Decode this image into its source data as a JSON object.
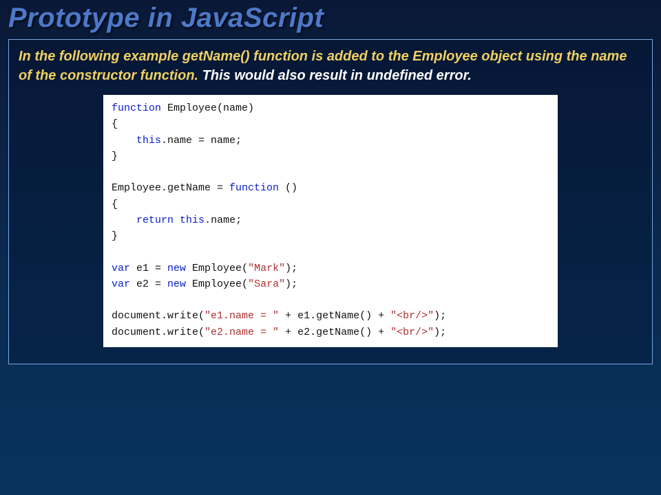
{
  "title": "Prototype in JavaScript",
  "explain_highlight": "In the following example getName() function is added to the Employee object using the name of the constructor function.",
  "explain_plain": " This would also result in undefined error.",
  "code": {
    "l01a": "function",
    "l01b": " Employee(name)",
    "l02": "{",
    "l03a": "    ",
    "l03b": "this",
    "l03c": ".name = name;",
    "l04": "}",
    "l05": "",
    "l06a": "Employee.getName = ",
    "l06b": "function",
    "l06c": " ()",
    "l07": "{",
    "l08a": "    ",
    "l08b": "return",
    "l08c": " ",
    "l08d": "this",
    "l08e": ".name;",
    "l09": "}",
    "l10": "",
    "l11a": "var",
    "l11b": " e1 = ",
    "l11c": "new",
    "l11d": " Employee(",
    "l11e": "\"Mark\"",
    "l11f": ");",
    "l12a": "var",
    "l12b": " e2 = ",
    "l12c": "new",
    "l12d": " Employee(",
    "l12e": "\"Sara\"",
    "l12f": ");",
    "l13": "",
    "l14a": "document.write(",
    "l14b": "\"e1.name = \"",
    "l14c": " + e1.getName() + ",
    "l14d": "\"<br/>\"",
    "l14e": ");",
    "l15a": "document.write(",
    "l15b": "\"e2.name = \"",
    "l15c": " + e2.getName() + ",
    "l15d": "\"<br/>\"",
    "l15e": ");"
  }
}
